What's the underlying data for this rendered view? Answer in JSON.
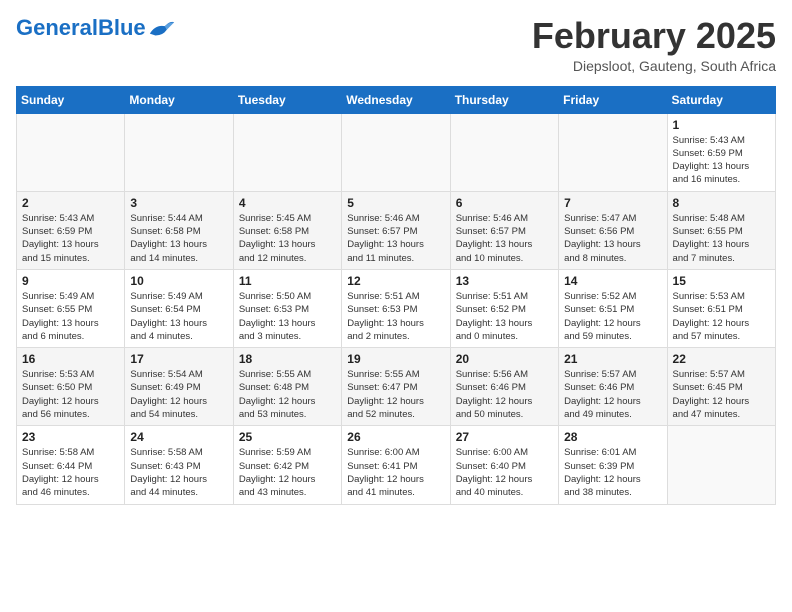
{
  "logo": {
    "text_general": "General",
    "text_blue": "Blue"
  },
  "header": {
    "month": "February 2025",
    "location": "Diepsloot, Gauteng, South Africa"
  },
  "weekdays": [
    "Sunday",
    "Monday",
    "Tuesday",
    "Wednesday",
    "Thursday",
    "Friday",
    "Saturday"
  ],
  "weeks": [
    [
      {
        "day": "",
        "info": ""
      },
      {
        "day": "",
        "info": ""
      },
      {
        "day": "",
        "info": ""
      },
      {
        "day": "",
        "info": ""
      },
      {
        "day": "",
        "info": ""
      },
      {
        "day": "",
        "info": ""
      },
      {
        "day": "1",
        "info": "Sunrise: 5:43 AM\nSunset: 6:59 PM\nDaylight: 13 hours\nand 16 minutes."
      }
    ],
    [
      {
        "day": "2",
        "info": "Sunrise: 5:43 AM\nSunset: 6:59 PM\nDaylight: 13 hours\nand 15 minutes."
      },
      {
        "day": "3",
        "info": "Sunrise: 5:44 AM\nSunset: 6:58 PM\nDaylight: 13 hours\nand 14 minutes."
      },
      {
        "day": "4",
        "info": "Sunrise: 5:45 AM\nSunset: 6:58 PM\nDaylight: 13 hours\nand 12 minutes."
      },
      {
        "day": "5",
        "info": "Sunrise: 5:46 AM\nSunset: 6:57 PM\nDaylight: 13 hours\nand 11 minutes."
      },
      {
        "day": "6",
        "info": "Sunrise: 5:46 AM\nSunset: 6:57 PM\nDaylight: 13 hours\nand 10 minutes."
      },
      {
        "day": "7",
        "info": "Sunrise: 5:47 AM\nSunset: 6:56 PM\nDaylight: 13 hours\nand 8 minutes."
      },
      {
        "day": "8",
        "info": "Sunrise: 5:48 AM\nSunset: 6:55 PM\nDaylight: 13 hours\nand 7 minutes."
      }
    ],
    [
      {
        "day": "9",
        "info": "Sunrise: 5:49 AM\nSunset: 6:55 PM\nDaylight: 13 hours\nand 6 minutes."
      },
      {
        "day": "10",
        "info": "Sunrise: 5:49 AM\nSunset: 6:54 PM\nDaylight: 13 hours\nand 4 minutes."
      },
      {
        "day": "11",
        "info": "Sunrise: 5:50 AM\nSunset: 6:53 PM\nDaylight: 13 hours\nand 3 minutes."
      },
      {
        "day": "12",
        "info": "Sunrise: 5:51 AM\nSunset: 6:53 PM\nDaylight: 13 hours\nand 2 minutes."
      },
      {
        "day": "13",
        "info": "Sunrise: 5:51 AM\nSunset: 6:52 PM\nDaylight: 13 hours\nand 0 minutes."
      },
      {
        "day": "14",
        "info": "Sunrise: 5:52 AM\nSunset: 6:51 PM\nDaylight: 12 hours\nand 59 minutes."
      },
      {
        "day": "15",
        "info": "Sunrise: 5:53 AM\nSunset: 6:51 PM\nDaylight: 12 hours\nand 57 minutes."
      }
    ],
    [
      {
        "day": "16",
        "info": "Sunrise: 5:53 AM\nSunset: 6:50 PM\nDaylight: 12 hours\nand 56 minutes."
      },
      {
        "day": "17",
        "info": "Sunrise: 5:54 AM\nSunset: 6:49 PM\nDaylight: 12 hours\nand 54 minutes."
      },
      {
        "day": "18",
        "info": "Sunrise: 5:55 AM\nSunset: 6:48 PM\nDaylight: 12 hours\nand 53 minutes."
      },
      {
        "day": "19",
        "info": "Sunrise: 5:55 AM\nSunset: 6:47 PM\nDaylight: 12 hours\nand 52 minutes."
      },
      {
        "day": "20",
        "info": "Sunrise: 5:56 AM\nSunset: 6:46 PM\nDaylight: 12 hours\nand 50 minutes."
      },
      {
        "day": "21",
        "info": "Sunrise: 5:57 AM\nSunset: 6:46 PM\nDaylight: 12 hours\nand 49 minutes."
      },
      {
        "day": "22",
        "info": "Sunrise: 5:57 AM\nSunset: 6:45 PM\nDaylight: 12 hours\nand 47 minutes."
      }
    ],
    [
      {
        "day": "23",
        "info": "Sunrise: 5:58 AM\nSunset: 6:44 PM\nDaylight: 12 hours\nand 46 minutes."
      },
      {
        "day": "24",
        "info": "Sunrise: 5:58 AM\nSunset: 6:43 PM\nDaylight: 12 hours\nand 44 minutes."
      },
      {
        "day": "25",
        "info": "Sunrise: 5:59 AM\nSunset: 6:42 PM\nDaylight: 12 hours\nand 43 minutes."
      },
      {
        "day": "26",
        "info": "Sunrise: 6:00 AM\nSunset: 6:41 PM\nDaylight: 12 hours\nand 41 minutes."
      },
      {
        "day": "27",
        "info": "Sunrise: 6:00 AM\nSunset: 6:40 PM\nDaylight: 12 hours\nand 40 minutes."
      },
      {
        "day": "28",
        "info": "Sunrise: 6:01 AM\nSunset: 6:39 PM\nDaylight: 12 hours\nand 38 minutes."
      },
      {
        "day": "",
        "info": ""
      }
    ]
  ]
}
